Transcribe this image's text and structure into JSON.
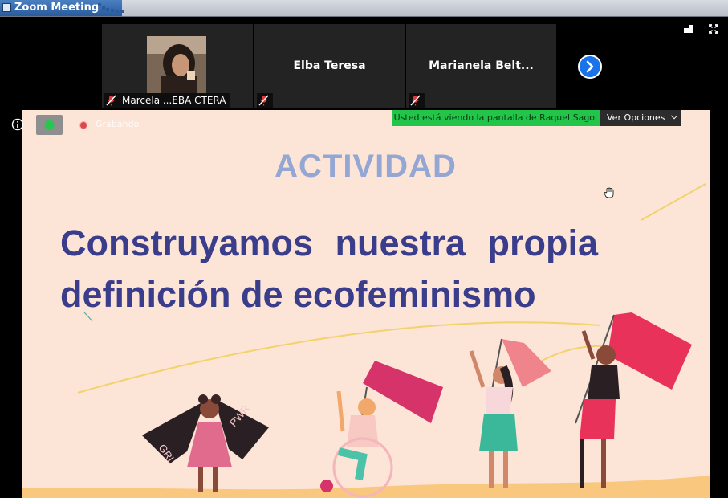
{
  "window": {
    "title": "Zoom Meeting"
  },
  "participants": [
    {
      "name": "Marcela ...EBA CTERA",
      "has_video": true,
      "muted": true
    },
    {
      "name": "Elba Teresa",
      "has_video": false,
      "muted": true
    },
    {
      "name": "Marianela Belt...",
      "has_video": false,
      "muted": true
    }
  ],
  "toolbar": {
    "recording_label": "Grabando",
    "viewing_banner": "Usted está viendo la pantalla de Raquel Sagot",
    "view_options_label": "Ver Opciones"
  },
  "slide": {
    "kicker": "ACTIVIDAD",
    "headline_line1_words": [
      "Construyamos",
      "nuestra",
      "propia"
    ],
    "headline_line2": "definición de ecofeminismo",
    "shirt_text_left": "GRL",
    "shirt_text_right": "PWR"
  },
  "colors": {
    "slide_bg": "#fce4d6",
    "kicker": "#94a6d4",
    "headline": "#3a3d8c",
    "banner_green": "#23c44a",
    "flag_pink": "#e8336e"
  },
  "icons": [
    "mic-muted-icon",
    "next-page-icon",
    "speaker-view-icon",
    "fullscreen-icon",
    "info-icon",
    "security-icon",
    "recording-icon",
    "hand-cursor-icon"
  ]
}
